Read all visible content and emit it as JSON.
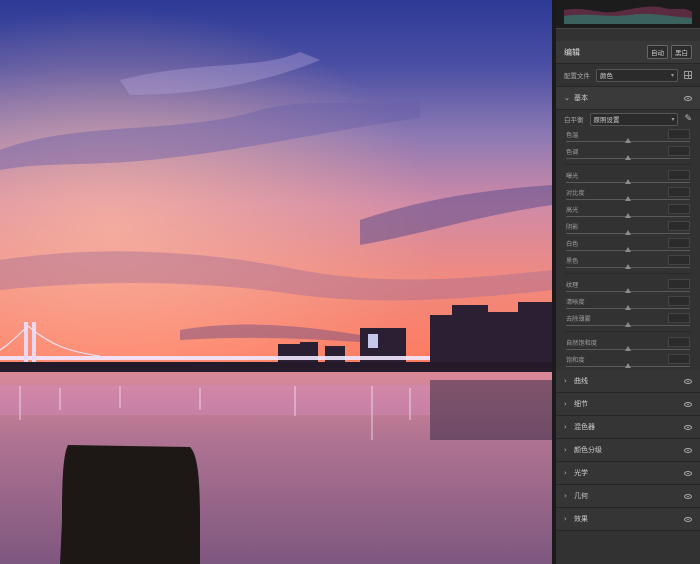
{
  "panel": {
    "title": "编辑",
    "auto_label": "自动",
    "bw_label": "黑白",
    "profile_label": "配置文件",
    "profile_value": "颜色",
    "basic_label": "基本",
    "wb_label": "白平衡",
    "wb_value": "原照设置",
    "sliders": [
      {
        "label": "色温",
        "pos": 0.5
      },
      {
        "label": "色调",
        "pos": 0.5
      },
      {
        "label": "曝光",
        "pos": 0.5
      },
      {
        "label": "对比度",
        "pos": 0.5
      },
      {
        "label": "高光",
        "pos": 0.5
      },
      {
        "label": "阴影",
        "pos": 0.5
      },
      {
        "label": "白色",
        "pos": 0.5
      },
      {
        "label": "黑色",
        "pos": 0.5
      },
      {
        "label": "纹理",
        "pos": 0.5
      },
      {
        "label": "清晰度",
        "pos": 0.5
      },
      {
        "label": "去除薄雾",
        "pos": 0.5
      },
      {
        "label": "自然饱和度",
        "pos": 0.5
      },
      {
        "label": "饱和度",
        "pos": 0.5
      }
    ],
    "sections": [
      "曲线",
      "细节",
      "混色器",
      "颜色分级",
      "光学",
      "几何",
      "效果"
    ]
  },
  "icons": {
    "collapse": "chevron-down-icon",
    "expand": "chevron-right-icon",
    "visibility": "eye-icon",
    "dropper": "eyedropper-icon",
    "profile_browser": "grid-icon"
  },
  "colors": {
    "panel_bg": "#323232",
    "sky_top": "#2f3a8f",
    "sky_glow": "#e76a63",
    "water": "#b26f88"
  }
}
